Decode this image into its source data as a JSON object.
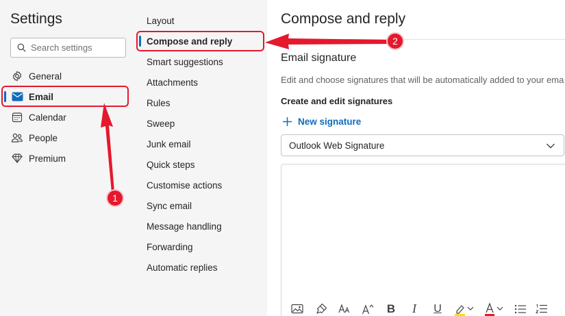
{
  "settings": {
    "title": "Settings",
    "search_placeholder": "Search settings",
    "nav": [
      {
        "label": "General",
        "icon": "gear-icon"
      },
      {
        "label": "Email",
        "icon": "mail-icon",
        "active": true
      },
      {
        "label": "Calendar",
        "icon": "calendar-icon"
      },
      {
        "label": "People",
        "icon": "people-icon"
      },
      {
        "label": "Premium",
        "icon": "diamond-icon"
      }
    ]
  },
  "email_menu": {
    "items": [
      {
        "label": "Layout"
      },
      {
        "label": "Compose and reply",
        "active": true
      },
      {
        "label": "Smart suggestions"
      },
      {
        "label": "Attachments"
      },
      {
        "label": "Rules"
      },
      {
        "label": "Sweep"
      },
      {
        "label": "Junk email"
      },
      {
        "label": "Quick steps"
      },
      {
        "label": "Customise actions"
      },
      {
        "label": "Sync email"
      },
      {
        "label": "Message handling"
      },
      {
        "label": "Forwarding"
      },
      {
        "label": "Automatic replies"
      }
    ]
  },
  "main": {
    "title": "Compose and reply",
    "section_title": "Email signature",
    "section_desc": "Edit and choose signatures that will be automatically added to your ema",
    "subsection": "Create and edit signatures",
    "new_signature": "New signature",
    "signature_select": "Outlook Web Signature",
    "toolbar": [
      "image-icon",
      "format-painter-icon",
      "font-size-icon",
      "grow-font-icon",
      "bold-icon",
      "italic-icon",
      "underline-icon",
      "highlight-icon",
      "font-color-icon",
      "bullets-icon",
      "numbering-icon"
    ],
    "toolbar_glyphs": {
      "bold": "B",
      "italic": "I",
      "underline": "U",
      "font_color": "A"
    }
  },
  "annotations": {
    "badge1": "1",
    "badge2": "2"
  },
  "colors": {
    "accent": "#0f6cbd",
    "callout": "#e5182d",
    "highlight_bar": "#f5e400",
    "font_color_bar": "#e5182d"
  }
}
